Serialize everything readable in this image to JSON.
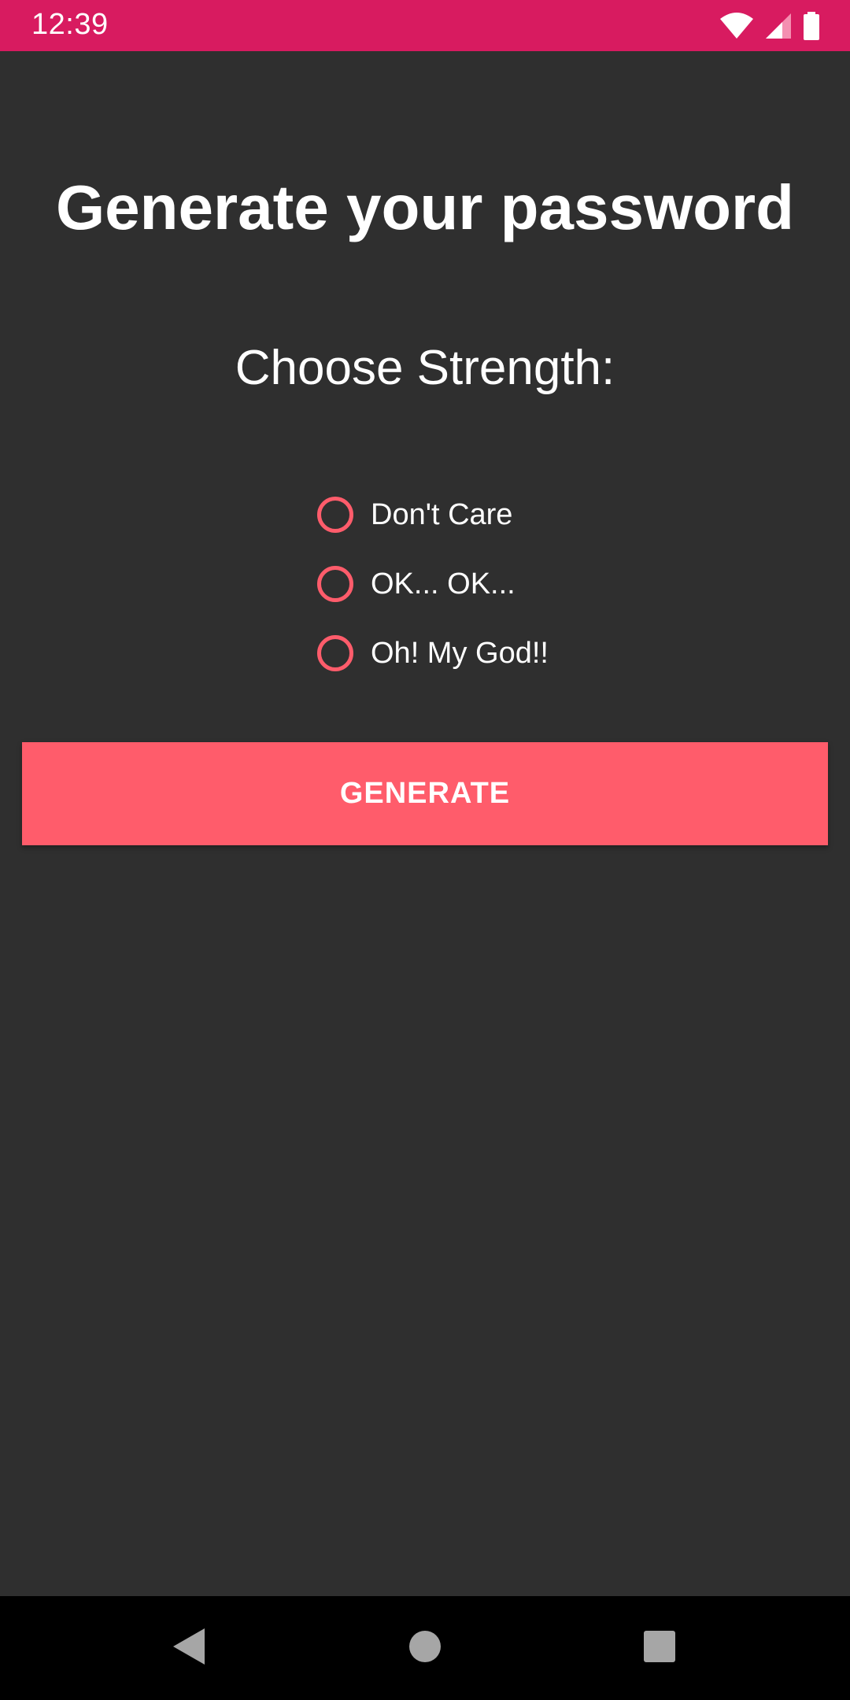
{
  "status_bar": {
    "time": "12:39",
    "background": "#d81b60",
    "icons": [
      "wifi-icon",
      "cell-signal-icon",
      "battery-icon"
    ]
  },
  "main": {
    "title": "Generate your password",
    "subtitle": "Choose Strength:",
    "strength_options": [
      {
        "label": "Don't Care",
        "selected": false
      },
      {
        "label": "OK... OK...",
        "selected": false
      },
      {
        "label": "Oh! My God!!",
        "selected": false
      }
    ],
    "generate_label": "GENERATE",
    "accent_color": "#ff5c6b",
    "background": "#2f2f2f"
  },
  "nav_bar": {
    "buttons": [
      "back-icon",
      "home-icon",
      "recents-icon"
    ]
  }
}
